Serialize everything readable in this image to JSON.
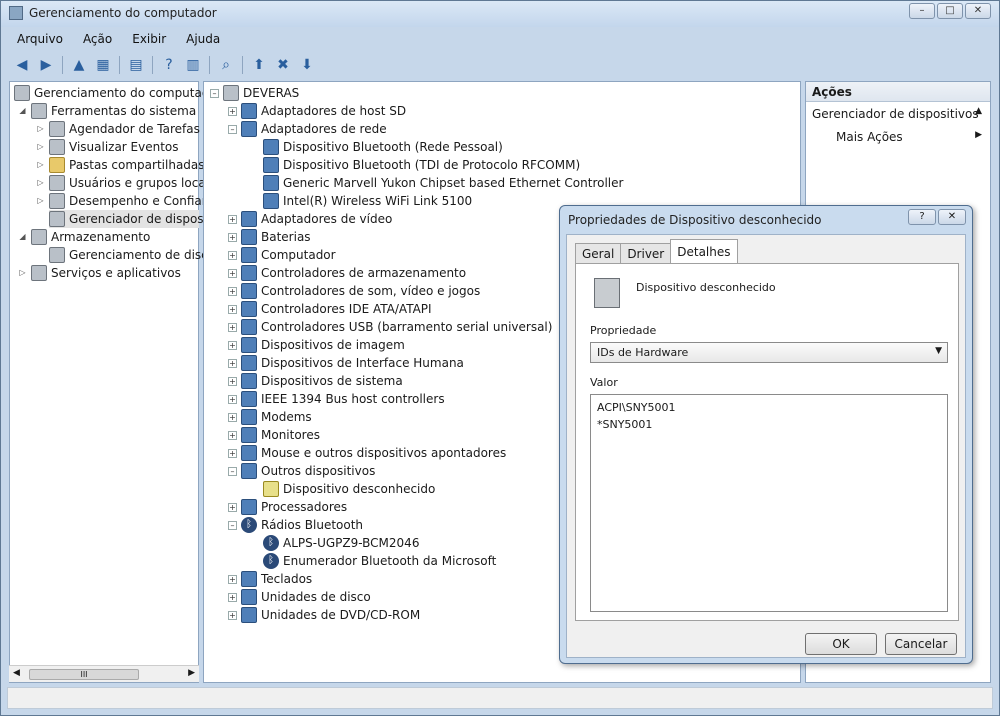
{
  "window": {
    "title": "Gerenciamento do computador",
    "min": "–",
    "max": "□",
    "close": "✕"
  },
  "menus": [
    "Arquivo",
    "Ação",
    "Exibir",
    "Ajuda"
  ],
  "left_tree": {
    "root": "Gerenciamento do computado",
    "items": [
      {
        "label": "Ferramentas do sistema",
        "level": 1
      },
      {
        "label": "Agendador de Tarefas",
        "level": 2
      },
      {
        "label": "Visualizar Eventos",
        "level": 2
      },
      {
        "label": "Pastas compartilhadas",
        "level": 2
      },
      {
        "label": "Usuários e grupos locais",
        "level": 2
      },
      {
        "label": "Desempenho e Confian",
        "level": 2
      },
      {
        "label": "Gerenciador de disposit",
        "level": 2
      },
      {
        "label": "Armazenamento",
        "level": 1
      },
      {
        "label": "Gerenciamento de disco",
        "level": 2
      },
      {
        "label": "Serviços e aplicativos",
        "level": 1
      }
    ],
    "scroll_thumb": "III"
  },
  "device_tree": {
    "root": "DEVERAS",
    "items": [
      {
        "label": "Adaptadores de host SD",
        "level": 1,
        "exp": "+"
      },
      {
        "label": "Adaptadores de rede",
        "level": 1,
        "exp": "–"
      },
      {
        "label": "Dispositivo Bluetooth (Rede Pessoal)",
        "level": 2
      },
      {
        "label": "Dispositivo Bluetooth (TDI de Protocolo RFCOMM)",
        "level": 2
      },
      {
        "label": "Generic Marvell Yukon Chipset based Ethernet Controller",
        "level": 2
      },
      {
        "label": "Intel(R) Wireless WiFi Link 5100",
        "level": 2
      },
      {
        "label": "Adaptadores de vídeo",
        "level": 1,
        "exp": "+"
      },
      {
        "label": "Baterias",
        "level": 1,
        "exp": "+"
      },
      {
        "label": "Computador",
        "level": 1,
        "exp": "+"
      },
      {
        "label": "Controladores de armazenamento",
        "level": 1,
        "exp": "+"
      },
      {
        "label": "Controladores de som, vídeo e jogos",
        "level": 1,
        "exp": "+"
      },
      {
        "label": "Controladores IDE ATA/ATAPI",
        "level": 1,
        "exp": "+"
      },
      {
        "label": "Controladores USB (barramento serial universal)",
        "level": 1,
        "exp": "+"
      },
      {
        "label": "Dispositivos de imagem",
        "level": 1,
        "exp": "+"
      },
      {
        "label": "Dispositivos de Interface Humana",
        "level": 1,
        "exp": "+"
      },
      {
        "label": "Dispositivos de sistema",
        "level": 1,
        "exp": "+"
      },
      {
        "label": "IEEE 1394 Bus host controllers",
        "level": 1,
        "exp": "+"
      },
      {
        "label": "Modems",
        "level": 1,
        "exp": "+"
      },
      {
        "label": "Monitores",
        "level": 1,
        "exp": "+"
      },
      {
        "label": "Mouse e outros dispositivos apontadores",
        "level": 1,
        "exp": "+"
      },
      {
        "label": "Outros dispositivos",
        "level": 1,
        "exp": "–"
      },
      {
        "label": "Dispositivo desconhecido",
        "level": 2
      },
      {
        "label": "Processadores",
        "level": 1,
        "exp": "+"
      },
      {
        "label": "Rádios Bluetooth",
        "level": 1,
        "exp": "–"
      },
      {
        "label": "ALPS-UGPZ9-BCM2046",
        "level": 2
      },
      {
        "label": "Enumerador Bluetooth da Microsoft",
        "level": 2
      },
      {
        "label": "Teclados",
        "level": 1,
        "exp": "+"
      },
      {
        "label": "Unidades de disco",
        "level": 1,
        "exp": "+"
      },
      {
        "label": "Unidades de DVD/CD-ROM",
        "level": 1,
        "exp": "+"
      }
    ]
  },
  "actions": {
    "header": "Ações",
    "section": "Gerenciador de dispositivos",
    "more": "Mais Ações"
  },
  "dialog": {
    "title": "Propriedades de Dispositivo desconhecido",
    "help": "?",
    "close": "✕",
    "tabs": [
      "Geral",
      "Driver",
      "Detalhes"
    ],
    "device_name": "Dispositivo desconhecido",
    "property_label": "Propriedade",
    "property_value": "IDs de Hardware",
    "value_label": "Valor",
    "values": [
      "ACPI\\SNY5001",
      "*SNY5001"
    ],
    "ok": "OK",
    "cancel": "Cancelar"
  }
}
